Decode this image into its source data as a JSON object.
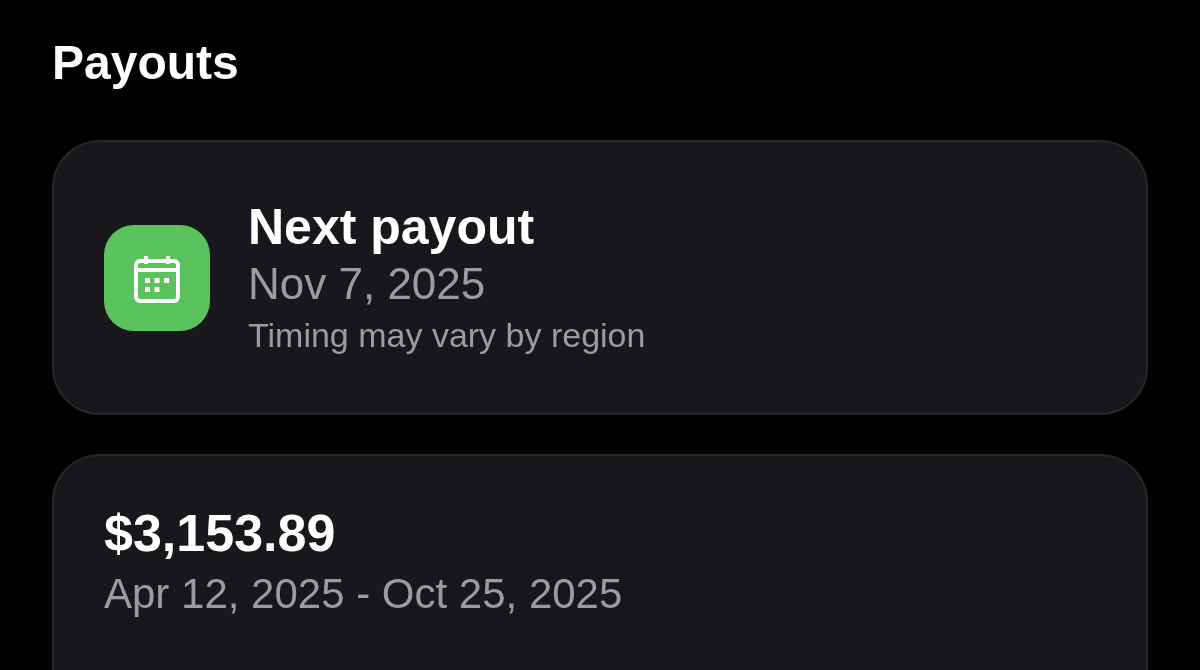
{
  "page": {
    "title": "Payouts"
  },
  "next_payout": {
    "title": "Next payout",
    "date": "Nov 7, 2025",
    "note": "Timing may vary by region"
  },
  "payout_summary": {
    "amount": "$3,153.89",
    "period": "Apr 12, 2025 - Oct 25, 2025"
  }
}
